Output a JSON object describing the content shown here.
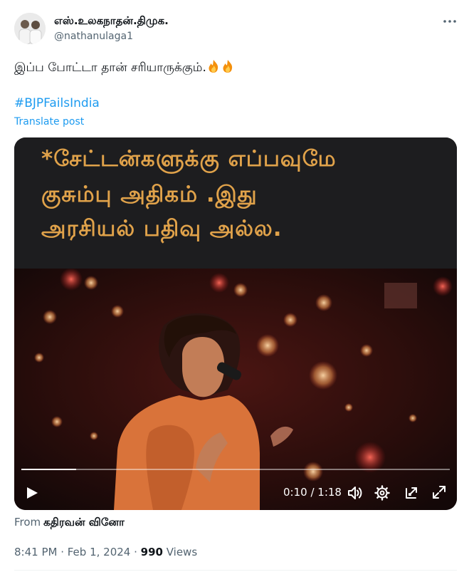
{
  "post": {
    "author_name": "எஸ்.உலகநாதன்.திமுக.",
    "author_handle": "@nathanulaga1",
    "text": "இப்ப போட்டா தான் சரியாருக்கும்.",
    "emoji": "🔥🔥",
    "hashtag": "#BJPFailsIndia",
    "translate_label": "Translate post",
    "more_icon": "more-horizontal-icon"
  },
  "video": {
    "caption_lines": [
      "*சேட்டன்களுக்கு எப்பவுமே",
      "குசும்பு அதிகம்  .இது",
      "அரசியல் பதிவு அல்ல."
    ],
    "current_time": "0:10",
    "duration": "1:18",
    "time_display": "0:10 / 1:18",
    "progress": 0.128,
    "icons": [
      "play-icon",
      "volume-icon",
      "settings-icon",
      "popout-icon",
      "fullscreen-icon"
    ],
    "caption_color": "#e0a24a"
  },
  "attribution": {
    "from_label": "From",
    "from_name": "கதிரவன் வினோ"
  },
  "meta": {
    "time_date": "8:41 PM · Feb 1, 2024 · ",
    "views_count": "990",
    "views_label": " Views"
  },
  "colors": {
    "link": "#1d9bf0",
    "secondary_text": "#536471",
    "primary_text": "#0f1419"
  }
}
